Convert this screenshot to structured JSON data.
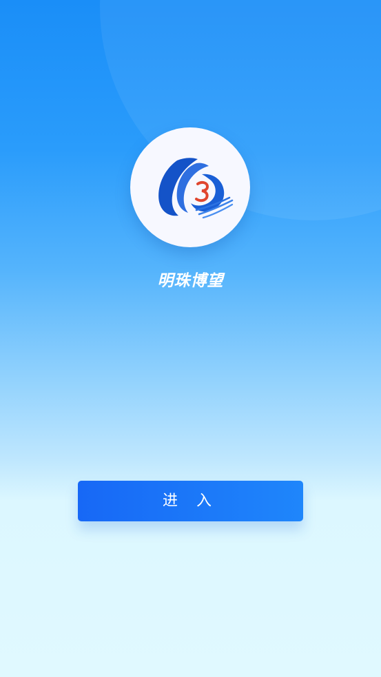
{
  "splash": {
    "brand_name": "明珠博望",
    "enter_label": "进 入"
  },
  "colors": {
    "top_blue": "#1a8ef8",
    "bottom_cyan": "#e0f9ff",
    "button_start": "#1768f6",
    "button_end": "#1f86fb",
    "logo_blue": "#1453c8",
    "logo_red": "#e0462f"
  },
  "icons": {
    "logo": "mingzhu-bowang-logo-icon"
  }
}
